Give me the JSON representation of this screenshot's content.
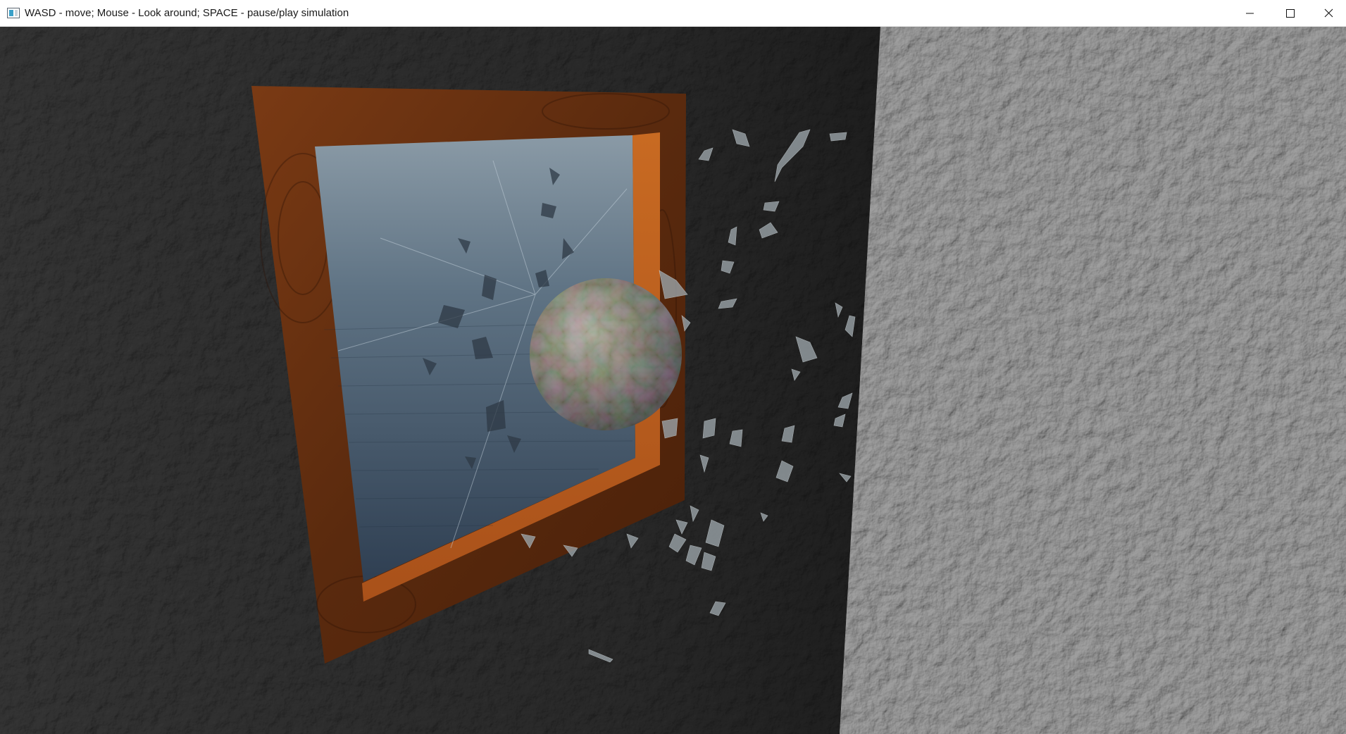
{
  "window": {
    "title": "WASD - move; Mouse - Look around; SPACE - pause/play simulation",
    "icon": "application-window-icon",
    "controls": {
      "minimize_icon": "minimize-icon",
      "maximize_icon": "maximize-icon",
      "close_icon": "close-icon"
    }
  },
  "scene": {
    "description_objects": [
      "dark-wall",
      "light-wall",
      "wooden-window-frame",
      "glass-pane",
      "marble-ball",
      "glass-shards"
    ],
    "colors": {
      "dark_wall": "#2b2b2b",
      "light_wall": "#8a8a8a",
      "frame_wood": "#6a2f10",
      "frame_inner_highlight": "#b85a1c",
      "glass": "#5c6e80",
      "ball_base": "#7d7a5e"
    }
  }
}
